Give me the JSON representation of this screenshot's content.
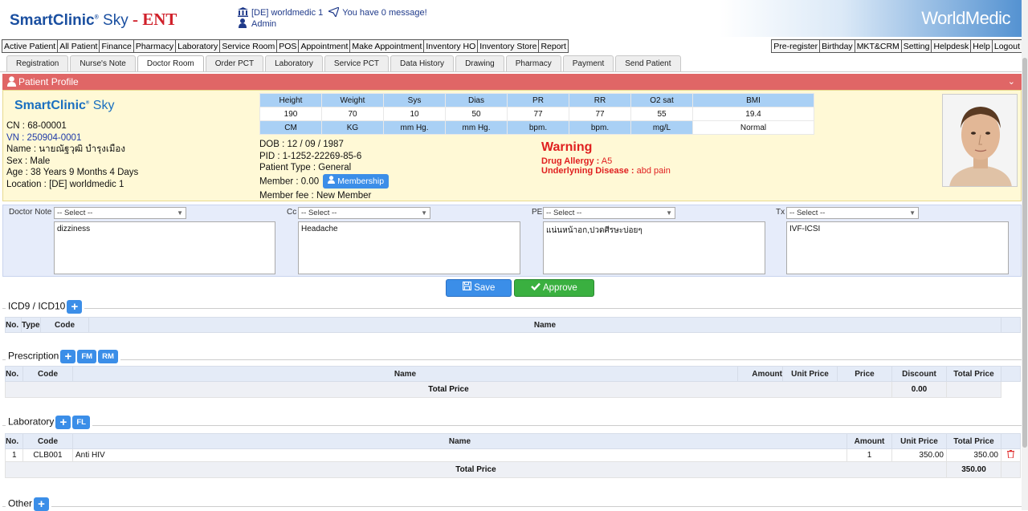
{
  "header": {
    "logo_main": "SmartClinic",
    "logo_sky": "Sky",
    "logo_suffix": "- ENT",
    "branch": "[DE] worldmedic 1",
    "message": "You have 0 message!",
    "user": "Admin",
    "brand": "WorldMedic"
  },
  "menu_left": [
    "Active Patient",
    "All Patient",
    "Finance",
    "Pharmacy",
    "Laboratory",
    "Service Room",
    "POS",
    "Appointment",
    "Make Appointment",
    "Inventory HO",
    "Inventory Store",
    "Report"
  ],
  "menu_right": [
    "Pre-register",
    "Birthday",
    "MKT&CRM",
    "Setting",
    "Helpdesk",
    "Help",
    "Logout"
  ],
  "tabs": [
    "Registration",
    "Nurse's Note",
    "Doctor Room",
    "Order PCT",
    "Laboratory",
    "Service PCT",
    "Data History",
    "Drawing",
    "Pharmacy",
    "Payment",
    "Send Patient"
  ],
  "active_tab": "Doctor Room",
  "profile": {
    "title": "Patient Profile",
    "logo_main": "SmartClinic",
    "logo_sky": "Sky",
    "cn": "CN : 68-00001",
    "vn": "VN : 250904-0001",
    "name": "Name : นายณัฐวุฒิ บำรุงเมือง",
    "sex": "Sex : Male",
    "age": "Age : 38 Years 9 Months 4 Days",
    "location": "Location : [DE] worldmedic 1",
    "dob": "DOB : 12 / 09 / 1987",
    "pid": "PID : 1-1252-22269-85-6",
    "patient_type": "Patient Type : General",
    "member": "Member : 0.00",
    "membership_btn": "Membership",
    "member_fee": "Member fee : New Member",
    "warning_title": "Warning",
    "drug_allergy_label": "Drug Allergy :",
    "drug_allergy_value": "A5",
    "underlying_label": "Underlyning Disease :",
    "underlying_value": "abd pain"
  },
  "vitals": {
    "headers": [
      "Height",
      "Weight",
      "Sys",
      "Dias",
      "PR",
      "RR",
      "O2 sat",
      "BMI"
    ],
    "values": [
      "190",
      "70",
      "10",
      "50",
      "77",
      "77",
      "55",
      "19.4"
    ],
    "units": [
      "CM",
      "KG",
      "mm Hg.",
      "mm Hg.",
      "bpm.",
      "bpm.",
      "mg/L",
      "Normal"
    ]
  },
  "notes": {
    "doctor_note_label": "Doctor Note",
    "cc_label": "Cc",
    "pe_label": "PE",
    "tx_label": "Tx",
    "select_placeholder": "-- Select --",
    "doctor_note_text": "dizziness",
    "cc_text": "Headache",
    "pe_text": "แน่นหน้าอก,ปวดศีรษะบ่อยๆ",
    "tx_text": "IVF-ICSI"
  },
  "actions": {
    "save": "Save",
    "approve": "Approve"
  },
  "icd": {
    "title": "ICD9 / ICD10",
    "columns": [
      "No.",
      "Type",
      "Code",
      "Name"
    ]
  },
  "prescription": {
    "title": "Prescription",
    "btn_fm": "FM",
    "btn_rm": "RM",
    "columns": [
      "No.",
      "Code",
      "Name",
      "Amount",
      "Unit Price",
      "Price",
      "Discount",
      "Total Price"
    ],
    "total_label": "Total Price",
    "total_value": "0.00"
  },
  "laboratory": {
    "title": "Laboratory",
    "btn_fl": "FL",
    "columns": [
      "No.",
      "Code",
      "Name",
      "Amount",
      "Unit Price",
      "Total Price"
    ],
    "rows": [
      {
        "no": "1",
        "code": "CLB001",
        "name": "Anti HIV",
        "amount": "1",
        "unit_price": "350.00",
        "total": "350.00"
      }
    ],
    "total_label": "Total Price",
    "total_value": "350.00"
  },
  "other": {
    "title": "Other"
  }
}
